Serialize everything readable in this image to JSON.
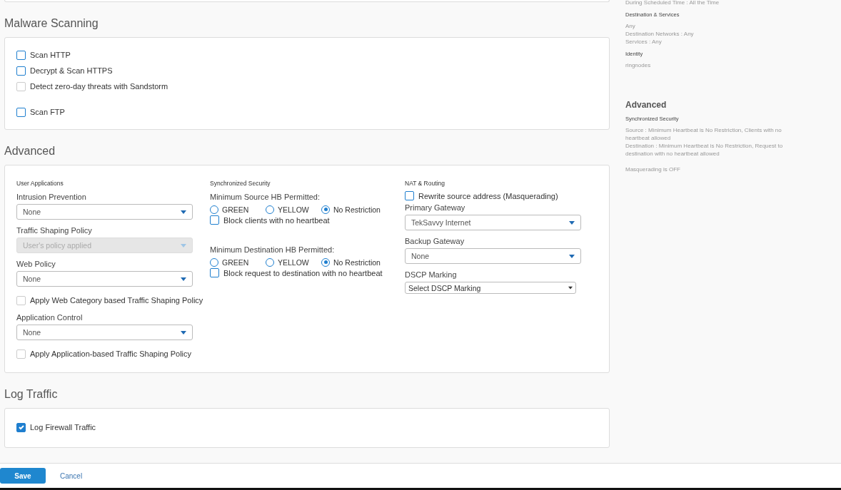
{
  "malware_scanning": {
    "title": "Malware Scanning",
    "options": [
      {
        "label": "Scan HTTP",
        "checked": false,
        "disabled": false
      },
      {
        "label": "Decrypt & Scan HTTPS",
        "checked": false,
        "disabled": false
      },
      {
        "label": "Detect zero-day threats with Sandstorm",
        "checked": false,
        "disabled": true
      },
      {
        "label": "Scan FTP",
        "checked": false,
        "disabled": false
      }
    ]
  },
  "advanced": {
    "title": "Advanced",
    "user_applications": {
      "heading": "User Applications",
      "items": [
        {
          "kind": "select",
          "label": "Intrusion Prevention",
          "value": "None",
          "disabled": false
        },
        {
          "kind": "select",
          "label": "Traffic Shaping Policy",
          "value": "User's policy applied",
          "disabled": true
        },
        {
          "kind": "select",
          "label": "Web Policy",
          "value": "None",
          "disabled": false
        },
        {
          "kind": "checkbox",
          "label": "Apply Web Category based Traffic Shaping Policy",
          "checked": false,
          "disabled": true
        },
        {
          "kind": "select",
          "label": "Application Control",
          "value": "None",
          "disabled": false
        },
        {
          "kind": "checkbox",
          "label": "Apply Application-based Traffic Shaping Policy",
          "checked": false,
          "disabled": true
        }
      ]
    },
    "synchronized_security": {
      "heading": "Synchronized Security",
      "groups": [
        {
          "label": "Minimum Source HB Permitted:",
          "radios": [
            {
              "label": "GREEN",
              "selected": false
            },
            {
              "label": "YELLOW",
              "selected": false
            },
            {
              "label": "No Restriction",
              "selected": true
            }
          ],
          "checkbox": {
            "label": "Block clients with no heartbeat",
            "checked": false
          }
        },
        {
          "label": "Minimum Destination HB Permitted:",
          "radios": [
            {
              "label": "GREEN",
              "selected": false
            },
            {
              "label": "YELLOW",
              "selected": false
            },
            {
              "label": "No Restriction",
              "selected": true
            }
          ],
          "checkbox": {
            "label": "Block request to destination with no heartbeat",
            "checked": false
          }
        }
      ]
    },
    "nat_routing": {
      "heading": "NAT & Routing",
      "items": [
        {
          "kind": "checkbox",
          "label": "Rewrite source address (Masquerading)",
          "checked": false
        },
        {
          "kind": "select",
          "label": "Primary Gateway",
          "value": "TekSavvy Internet"
        },
        {
          "kind": "select",
          "label": "Backup Gateway",
          "value": "None"
        },
        {
          "kind": "native",
          "label": "DSCP Marking",
          "value": "Select DSCP Marking"
        }
      ]
    }
  },
  "log_traffic": {
    "title": "Log Traffic",
    "options": [
      {
        "label": "Log Firewall Traffic",
        "checked": true
      }
    ]
  },
  "footer": {
    "save": "Save",
    "cancel": "Cancel"
  },
  "summary": [
    {
      "kind": "text",
      "text": "During Scheduled Time : All the Time"
    },
    {
      "kind": "label",
      "text": "Destination & Services"
    },
    {
      "kind": "text",
      "text": "Any"
    },
    {
      "kind": "text",
      "text": "Destination Networks : Any"
    },
    {
      "kind": "text",
      "text": "Services : Any"
    },
    {
      "kind": "label",
      "text": "Identity"
    },
    {
      "kind": "text",
      "text": "ringnodes"
    },
    {
      "kind": "title",
      "text": "Advanced"
    },
    {
      "kind": "label",
      "text": "Synchronized Security"
    },
    {
      "kind": "text",
      "text": "Source : Minimum Heartbeat is No Restriction, Clients with no heartbeat allowed"
    },
    {
      "kind": "text",
      "text": "Destination : Minimum Heartbeat is No Restriction, Request to destination with no heartbeat allowed"
    },
    {
      "kind": "text",
      "text": "Masquerading is OFF"
    }
  ]
}
